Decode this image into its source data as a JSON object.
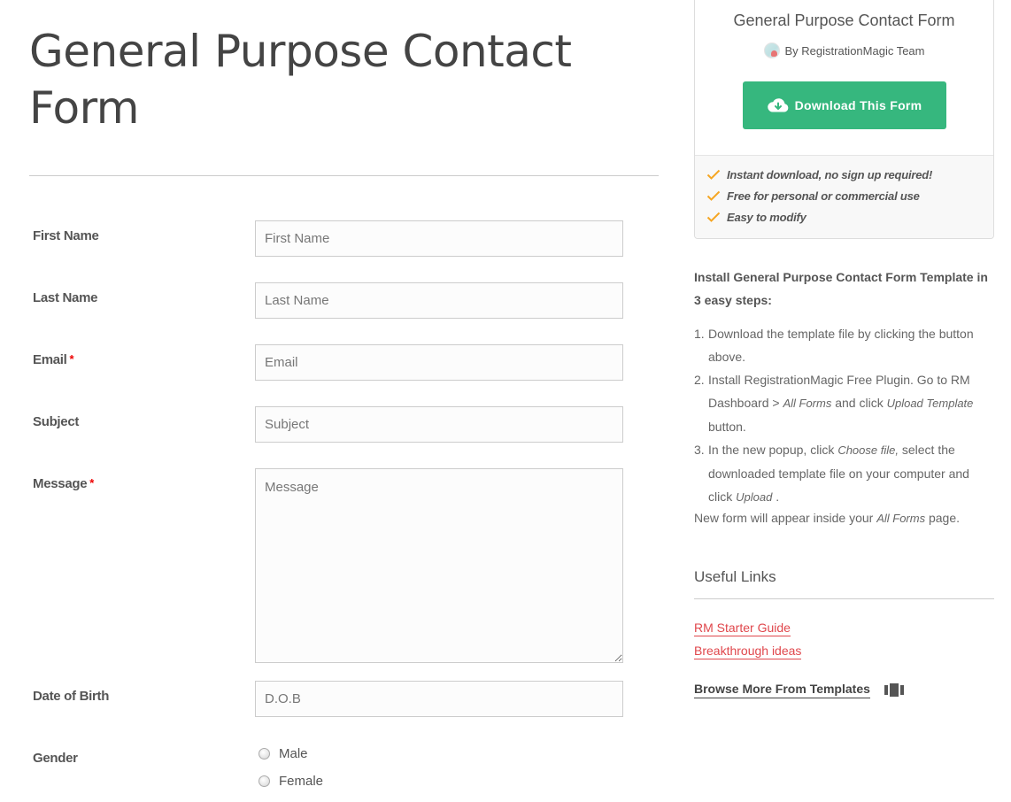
{
  "page": {
    "title": "General Purpose Contact Form"
  },
  "form": {
    "fields": [
      {
        "label": "First Name",
        "placeholder": "First Name",
        "required": false
      },
      {
        "label": "Last Name",
        "placeholder": "Last Name",
        "required": false
      },
      {
        "label": "Email",
        "placeholder": "Email",
        "required": true
      },
      {
        "label": "Subject",
        "placeholder": "Subject",
        "required": false
      },
      {
        "label": "Message",
        "placeholder": "Message",
        "required": true
      },
      {
        "label": "Date of Birth",
        "placeholder": "D.O.B",
        "required": false
      },
      {
        "label": "Gender",
        "required": false
      }
    ],
    "required_marker": "*",
    "gender_options": [
      "Male",
      "Female"
    ]
  },
  "sidebar": {
    "card": {
      "title": "General Purpose Contact Form",
      "author": "By RegistrationMagic Team",
      "download_label": "Download This Form",
      "features": [
        "Instant download, no sign up required!",
        "Free for personal or commercial use",
        "Easy to modify"
      ],
      "accent_color": "#36b77e",
      "check_color": "#f5a623"
    },
    "install": {
      "heading": "Install General Purpose Contact Form Template in 3 easy steps:",
      "steps": [
        {
          "num": "1.",
          "parts": [
            "Download the template file by clicking the button above."
          ]
        },
        {
          "num": "2.",
          "parts": [
            "Install RegistrationMagic Free Plugin. Go to RM Dashboard > ",
            "All Forms",
            " and click ",
            "Upload Template",
            " button."
          ]
        },
        {
          "num": "3.",
          "parts": [
            "In the new popup, click ",
            "Choose file,",
            " select the downloaded template file on your computer and click ",
            "Upload",
            " ."
          ]
        }
      ],
      "footer_parts": [
        "New form will appear inside your ",
        "All Forms",
        " page."
      ]
    },
    "useful_links": {
      "heading": "Useful Links",
      "links": [
        "RM Starter Guide",
        "Breakthrough ideas"
      ],
      "link_color": "#e0474c",
      "browse_label": "Browse More From Templates"
    }
  }
}
